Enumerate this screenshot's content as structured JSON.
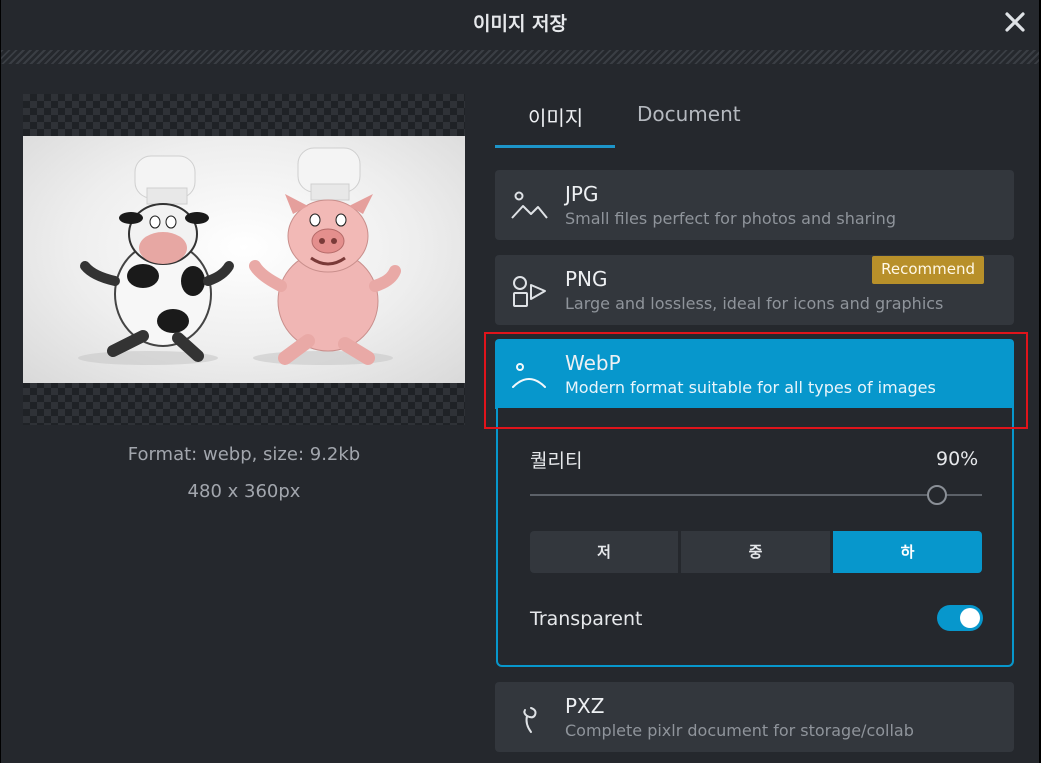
{
  "dialog": {
    "title": "이미지 저장",
    "close_icon": "close-icon"
  },
  "preview": {
    "format_info": "Format: webp, size: 9.2kb",
    "dimensions": "480 x 360px"
  },
  "tabs": [
    {
      "label": "이미지",
      "active": true
    },
    {
      "label": "Document",
      "active": false
    }
  ],
  "formats": {
    "jpg": {
      "name": "JPG",
      "desc": "Small files perfect for photos and sharing",
      "icon": "mountain-icon"
    },
    "png": {
      "name": "PNG",
      "desc": "Large and lossless, ideal for icons and graphics",
      "icon": "shapes-icon",
      "badge": "Recommend"
    },
    "webp": {
      "name": "WebP",
      "desc": "Modern format suitable for all types of images",
      "icon": "arc-icon"
    },
    "pxz": {
      "name": "PXZ",
      "desc": "Complete pixlr document for storage/collab",
      "icon": "pin-icon"
    }
  },
  "webp_options": {
    "quality_label": "퀄리티",
    "quality_value": "90%",
    "quality_fraction": 0.9,
    "presets": [
      {
        "label": "저",
        "active": false
      },
      {
        "label": "중",
        "active": false
      },
      {
        "label": "하",
        "active": true
      }
    ],
    "transparent_label": "Transparent",
    "transparent_on": true
  },
  "colors": {
    "accent": "#0797cc",
    "badge": "#b8902a",
    "highlight": "#e0141b"
  }
}
